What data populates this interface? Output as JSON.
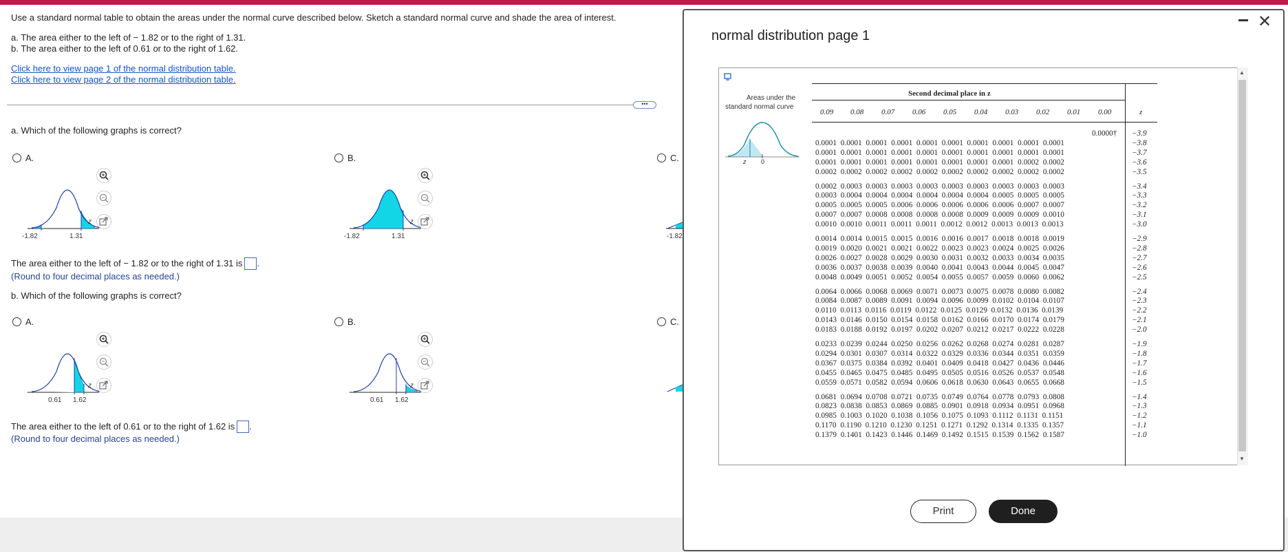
{
  "question": {
    "instruction": "Use a standard normal table to obtain the areas under the normal curve described below. Sketch a standard normal curve and shade the area of interest.",
    "part_a_text": "a. The area either to the left of  − 1.82 or to the right of 1.31.",
    "part_b_text": "b. The area either to the left of 0.61 or to the right of 1.62.",
    "link1": "Click here to view page 1 of the normal distribution table.",
    "link2": "Click here to view page 2 of the normal distribution table.",
    "more_button": "•••",
    "qa_prompt": "a. Which of the following graphs is correct?",
    "qb_prompt": "b. Which of the following graphs is correct?",
    "opt_a": "A.",
    "opt_b": "B.",
    "opt_c": "C.",
    "answer_a_text": "The area either to the left of  − 1.82 or to the right of 1.31 is",
    "answer_b_text": "The area either to the left of 0.61 or to the right of 1.62 is",
    "round_hint": "(Round to four decimal places as needed.)",
    "graph_a_labels": [
      "-1.82",
      "1.31"
    ],
    "graph_b_labels": [
      "0.61",
      "1.62"
    ],
    "graph_c_label": "-1.82",
    "z_label": "z"
  },
  "modal": {
    "title": "normal distribution page 1",
    "minimize": "−",
    "close": "✕",
    "curve_caption_1": "Areas under the",
    "curve_caption_2": "standard normal curve",
    "curve_z": "z",
    "curve_zero": "0",
    "second_decimal": "Second decimal place in z",
    "col_headers": [
      "0.09",
      "0.08",
      "0.07",
      "0.06",
      "0.05",
      "0.04",
      "0.03",
      "0.02",
      "0.01",
      "0.00"
    ],
    "z_header": "z",
    "first_value": "0.0000†",
    "rows": [
      {
        "vals": "",
        "z": "−3.9"
      },
      {
        "vals": "0.0001  0.0001  0.0001  0.0001  0.0001  0.0001  0.0001  0.0001  0.0001  0.0001",
        "z": "−3.8"
      },
      {
        "vals": "0.0001  0.0001  0.0001  0.0001  0.0001  0.0001  0.0001  0.0001  0.0001  0.0001",
        "z": "−3.7"
      },
      {
        "vals": "0.0001  0.0001  0.0001  0.0001  0.0001  0.0001  0.0001  0.0001  0.0002  0.0002",
        "z": "−3.6"
      },
      {
        "vals": "0.0002  0.0002  0.0002  0.0002  0.0002  0.0002  0.0002  0.0002  0.0002  0.0002",
        "z": "−3.5"
      },
      {
        "vals": "0.0002  0.0003  0.0003  0.0003  0.0003  0.0003  0.0003  0.0003  0.0003  0.0003",
        "z": "−3.4"
      },
      {
        "vals": "0.0003  0.0004  0.0004  0.0004  0.0004  0.0004  0.0004  0.0005  0.0005  0.0005",
        "z": "−3.3"
      },
      {
        "vals": "0.0005  0.0005  0.0005  0.0006  0.0006  0.0006  0.0006  0.0006  0.0007  0.0007",
        "z": "−3.2"
      },
      {
        "vals": "0.0007  0.0007  0.0008  0.0008  0.0008  0.0008  0.0009  0.0009  0.0009  0.0010",
        "z": "−3.1"
      },
      {
        "vals": "0.0010  0.0010  0.0011  0.0011  0.0011  0.0012  0.0012  0.0013  0.0013  0.0013",
        "z": "−3.0"
      },
      {
        "vals": "0.0014  0.0014  0.0015  0.0015  0.0016  0.0016  0.0017  0.0018  0.0018  0.0019",
        "z": "−2.9"
      },
      {
        "vals": "0.0019  0.0020  0.0021  0.0021  0.0022  0.0023  0.0023  0.0024  0.0025  0.0026",
        "z": "−2.8"
      },
      {
        "vals": "0.0026  0.0027  0.0028  0.0029  0.0030  0.0031  0.0032  0.0033  0.0034  0.0035",
        "z": "−2.7"
      },
      {
        "vals": "0.0036  0.0037  0.0038  0.0039  0.0040  0.0041  0.0043  0.0044  0.0045  0.0047",
        "z": "−2.6"
      },
      {
        "vals": "0.0048  0.0049  0.0051  0.0052  0.0054  0.0055  0.0057  0.0059  0.0060  0.0062",
        "z": "−2.5"
      },
      {
        "vals": "0.0064  0.0066  0.0068  0.0069  0.0071  0.0073  0.0075  0.0078  0.0080  0.0082",
        "z": "−2.4"
      },
      {
        "vals": "0.0084  0.0087  0.0089  0.0091  0.0094  0.0096  0.0099  0.0102  0.0104  0.0107",
        "z": "−2.3"
      },
      {
        "vals": "0.0110  0.0113  0.0116  0.0119  0.0122  0.0125  0.0129  0.0132  0.0136  0.0139",
        "z": "−2.2"
      },
      {
        "vals": "0.0143  0.0146  0.0150  0.0154  0.0158  0.0162  0.0166  0.0170  0.0174  0.0179",
        "z": "−2.1"
      },
      {
        "vals": "0.0183  0.0188  0.0192  0.0197  0.0202  0.0207  0.0212  0.0217  0.0222  0.0228",
        "z": "−2.0"
      },
      {
        "vals": "0.0233  0.0239  0.0244  0.0250  0.0256  0.0262  0.0268  0.0274  0.0281  0.0287",
        "z": "−1.9"
      },
      {
        "vals": "0.0294  0.0301  0.0307  0.0314  0.0322  0.0329  0.0336  0.0344  0.0351  0.0359",
        "z": "−1.8"
      },
      {
        "vals": "0.0367  0.0375  0.0384  0.0392  0.0401  0.0409  0.0418  0.0427  0.0436  0.0446",
        "z": "−1.7"
      },
      {
        "vals": "0.0455  0.0465  0.0475  0.0485  0.0495  0.0505  0.0516  0.0526  0.0537  0.0548",
        "z": "−1.6"
      },
      {
        "vals": "0.0559  0.0571  0.0582  0.0594  0.0606  0.0618  0.0630  0.0643  0.0655  0.0668",
        "z": "−1.5"
      },
      {
        "vals": "0.0681  0.0694  0.0708  0.0721  0.0735  0.0749  0.0764  0.0778  0.0793  0.0808",
        "z": "−1.4"
      },
      {
        "vals": "0.0823  0.0838  0.0853  0.0869  0.0885  0.0901  0.0918  0.0934  0.0951  0.0968",
        "z": "−1.3"
      },
      {
        "vals": "0.0985  0.1003  0.1020  0.1038  0.1056  0.1075  0.1093  0.1112  0.1131  0.1151",
        "z": "−1.2"
      },
      {
        "vals": "0.1170  0.1190  0.1210  0.1230  0.1251  0.1271  0.1292  0.1314  0.1335  0.1357",
        "z": "−1.1"
      },
      {
        "vals": "0.1379  0.1401  0.1423  0.1446  0.1469  0.1492  0.1515  0.1539  0.1562  0.1587",
        "z": "−1.0"
      }
    ],
    "print_label": "Print",
    "done_label": "Done"
  }
}
